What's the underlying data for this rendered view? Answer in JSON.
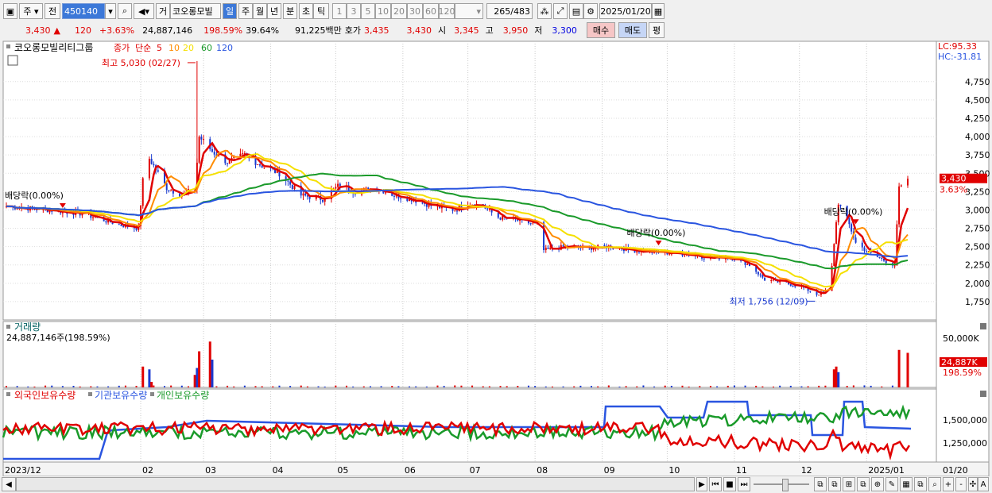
{
  "toolbar": {
    "market": "주",
    "mode": "전",
    "code": "450140",
    "type_btn": "거",
    "stock_name": "코오롱모빌",
    "periods": [
      "일",
      "주",
      "월",
      "년",
      "분",
      "초",
      "틱"
    ],
    "selected_period": "일",
    "intervals": [
      "1",
      "3",
      "5",
      "10",
      "20",
      "30",
      "60",
      "120"
    ],
    "count": "265",
    "total": "/483",
    "date": "2025/01/20"
  },
  "quote": {
    "price": "3,430",
    "change": "120",
    "change_pct": "+3.63%",
    "volume": "24,887,146",
    "volume_pct": "198.59%",
    "turnover_pct": "39.64%",
    "amount": "91,225백만",
    "ask_label": "호가",
    "ask": "3,435",
    "bid": "3,430",
    "open_label": "시",
    "open": "3,345",
    "high_label": "고",
    "high": "3,950",
    "low_label": "저",
    "low": "3,300",
    "buy_label": "매수",
    "sell_label": "매도",
    "avg_label": "평"
  },
  "chart_data": [
    {
      "type": "candlestick",
      "title": "코오롱모빌리티그룹",
      "legend": {
        "price_label": "종가",
        "ma_type": "단순",
        "ma_periods": [
          "5",
          "10",
          "20",
          "60",
          "120"
        ]
      },
      "ma_colors": {
        "5": "#e00000",
        "10": "#ff8c00",
        "20": "#f5e000",
        "60": "#1a9a2a",
        "120": "#2a55e0"
      },
      "yticks": [
        "4,750",
        "4,500",
        "4,250",
        "4,000",
        "3,750",
        "3,500",
        "3,250",
        "3,000",
        "2,750",
        "2,500",
        "2,250",
        "2,000",
        "1,750"
      ],
      "ylim": [
        1500,
        5300
      ],
      "lc_label": "LC:95.33",
      "hc_label": "HC:-31.81",
      "current_price_label": "3,430",
      "current_pct_label": "3.63%",
      "annotations": [
        {
          "text": "최고 5,030 (02/27)",
          "date": "2024-02-27",
          "value": 5030
        },
        {
          "text": "최저 1,756 (12/09)",
          "date": "2024-12-09",
          "value": 1756
        },
        {
          "text": "배당락(0.00%)",
          "date": "2023-12-27",
          "value": 3070
        },
        {
          "text": "배당락(0.00%)",
          "date": "2024-09-27",
          "value": 2560
        },
        {
          "text": "배당락(0.00%)",
          "date": "2024-12-27",
          "value": 2850
        }
      ],
      "close_anchors": [
        [
          "2023-12-01",
          3050
        ],
        [
          "2023-12-20",
          3000
        ],
        [
          "2024-01-05",
          2950
        ],
        [
          "2024-01-22",
          2800
        ],
        [
          "2024-01-31",
          2750
        ],
        [
          "2024-02-02",
          3400
        ],
        [
          "2024-02-05",
          3700
        ],
        [
          "2024-02-13",
          3300
        ],
        [
          "2024-02-20",
          3200
        ],
        [
          "2024-02-26",
          3300
        ],
        [
          "2024-02-28",
          4000
        ],
        [
          "2024-03-05",
          3800
        ],
        [
          "2024-03-12",
          3650
        ],
        [
          "2024-03-20",
          3750
        ],
        [
          "2024-03-28",
          3600
        ],
        [
          "2024-04-05",
          3500
        ],
        [
          "2024-04-15",
          3200
        ],
        [
          "2024-04-25",
          3150
        ],
        [
          "2024-05-03",
          3350
        ],
        [
          "2024-05-10",
          3250
        ],
        [
          "2024-05-20",
          3300
        ],
        [
          "2024-05-28",
          3200
        ],
        [
          "2024-06-05",
          3150
        ],
        [
          "2024-06-15",
          3050
        ],
        [
          "2024-06-25",
          3000
        ],
        [
          "2024-07-01",
          3100
        ],
        [
          "2024-07-08",
          3050
        ],
        [
          "2024-07-15",
          2900
        ],
        [
          "2024-07-25",
          2850
        ],
        [
          "2024-08-02",
          2800
        ],
        [
          "2024-08-05",
          2450
        ],
        [
          "2024-08-15",
          2500
        ],
        [
          "2024-08-25",
          2480
        ],
        [
          "2024-09-05",
          2500
        ],
        [
          "2024-09-15",
          2450
        ],
        [
          "2024-09-27",
          2420
        ],
        [
          "2024-10-10",
          2400
        ],
        [
          "2024-10-20",
          2350
        ],
        [
          "2024-10-31",
          2350
        ],
        [
          "2024-11-08",
          2250
        ],
        [
          "2024-11-15",
          2050
        ],
        [
          "2024-11-25",
          2000
        ],
        [
          "2024-12-02",
          1950
        ],
        [
          "2024-12-09",
          1850
        ],
        [
          "2024-12-15",
          1900
        ],
        [
          "2024-12-17",
          2550
        ],
        [
          "2024-12-19",
          3100
        ],
        [
          "2024-12-24",
          2800
        ],
        [
          "2024-12-27",
          2550
        ],
        [
          "2025-01-03",
          2400
        ],
        [
          "2025-01-10",
          2300
        ],
        [
          "2025-01-14",
          2250
        ],
        [
          "2025-01-16",
          3300
        ],
        [
          "2025-01-17",
          3300
        ],
        [
          "2025-01-20",
          3430
        ]
      ],
      "x_axis_labels": [
        "2023/12",
        "02",
        "03",
        "04",
        "05",
        "06",
        "07",
        "08",
        "09",
        "10",
        "11",
        "12",
        "2025/01",
        "01/20"
      ]
    },
    {
      "type": "bar",
      "title": "거래량",
      "subtitle": "24,887,146주(198.59%)",
      "ytick": "50,000K",
      "current_label": "24,887K",
      "current_pct": "198.59%",
      "spikes": [
        [
          "2024-02-02",
          15000
        ],
        [
          "2024-02-05",
          13000
        ],
        [
          "2024-02-06",
          4000
        ],
        [
          "2024-02-26",
          9000
        ],
        [
          "2024-02-27",
          14000
        ],
        [
          "2024-02-28",
          26000
        ],
        [
          "2024-03-04",
          33000
        ],
        [
          "2024-03-05",
          20000
        ],
        [
          "2024-12-17",
          13000
        ],
        [
          "2024-12-18",
          15000
        ],
        [
          "2024-12-19",
          11000
        ],
        [
          "2025-01-16",
          27000
        ],
        [
          "2025-01-20",
          24887
        ]
      ]
    },
    {
      "type": "line",
      "legend": [
        "외국인보유수량",
        "기관보유수량",
        "개인보유수량"
      ],
      "colors": [
        "#e00000",
        "#2a55e0",
        "#1a9a2a"
      ],
      "yticks": [
        "1,500,000",
        "1,250,000"
      ]
    }
  ],
  "scrollbar": {
    "buttons": [
      "▶",
      "⏮",
      "■",
      "⏭"
    ],
    "right_icons": [
      "+",
      "-",
      "A"
    ]
  }
}
